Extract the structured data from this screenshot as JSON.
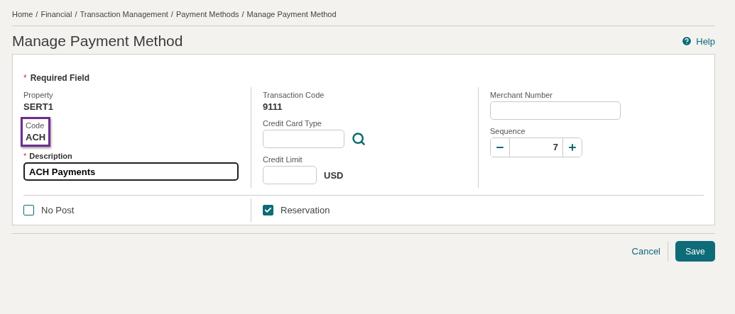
{
  "breadcrumb": [
    "Home",
    "Financial",
    "Transaction Management",
    "Payment Methods",
    "Manage Payment Method"
  ],
  "breadcrumb_separator": "/",
  "title": "Manage Payment Method",
  "help": {
    "label": "Help"
  },
  "required_note": {
    "marker": "*",
    "label": "Required Field"
  },
  "columns": [
    [
      {
        "kind": "readonly",
        "label": "Property",
        "value": "SERT1",
        "highlighted": false
      },
      {
        "kind": "readonly",
        "label": "Code",
        "value": "ACH",
        "highlighted": true
      },
      {
        "kind": "input",
        "label": "Description",
        "marker": "*",
        "value": "ACH Payments",
        "focused": true
      }
    ],
    [
      {
        "kind": "readonly",
        "label": "Transaction Code",
        "value": "9111",
        "highlighted": false
      },
      {
        "kind": "lookup",
        "label": "Credit Card Type"
      },
      {
        "kind": "amount",
        "label": "Credit Limit",
        "unit": "USD"
      }
    ],
    [
      {
        "kind": "input",
        "label": "Merchant Number",
        "focused": false
      },
      {
        "kind": "stepper",
        "label": "Sequence",
        "value": "7"
      }
    ]
  ],
  "checkboxes": [
    {
      "label": "No Post",
      "checked": false
    },
    {
      "label": "Reservation",
      "checked": true
    }
  ],
  "actions": {
    "cancel": "Cancel",
    "save": "Save"
  }
}
